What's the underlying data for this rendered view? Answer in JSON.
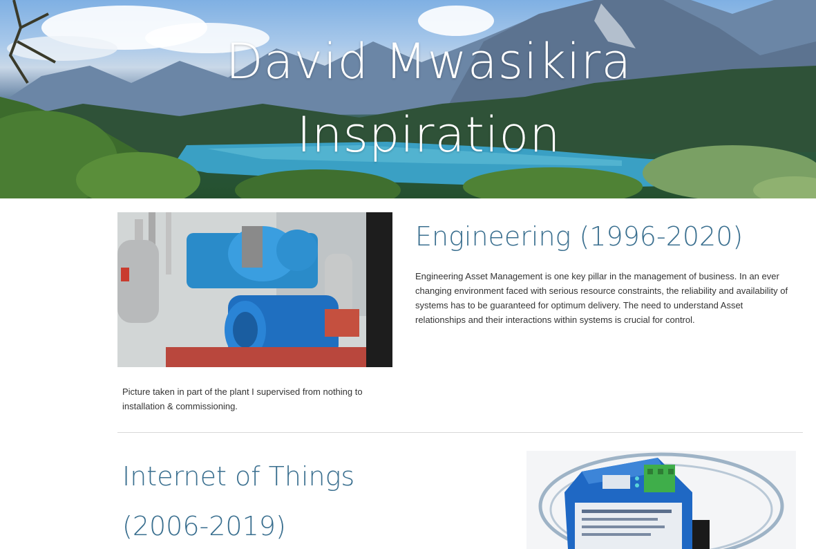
{
  "hero": {
    "title_line1": "David Mwasikira",
    "title_line2": "Inspiration"
  },
  "engineering": {
    "heading": "Engineering (1996-2020)",
    "body": "Engineering Asset Management is one key pillar in the management of business. In an ever changing environment faced with serious resource constraints, the reliability and availability of systems has to be guaranteed for optimum delivery. The need to understand Asset relationships and their interactions within systems is crucial for control.",
    "caption": "Picture taken in  part of the plant I supervised from nothing to installation & commissioning."
  },
  "iot": {
    "heading": "Internet of Things",
    "years": "(2006-2019)"
  },
  "colors": {
    "heading": "#3a6f8f",
    "text": "#333333",
    "divider": "#d8d8d8"
  }
}
